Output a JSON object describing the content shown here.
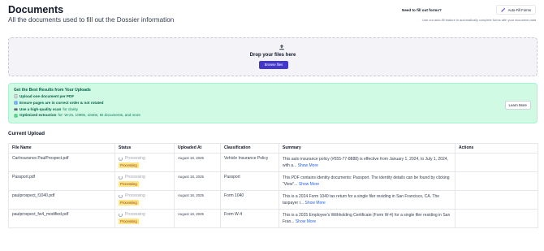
{
  "header": {
    "title": "Documents",
    "subtitle": "All the documents used to fill out the Dossier information"
  },
  "autofill": {
    "question": "Need to fill out forms?",
    "button_label": "Auto-Fill Forms",
    "note": "Use our auto-fill feature to automatically complete forms with your document data"
  },
  "dropzone": {
    "title": "Drop your files here",
    "button_label": "Browse files"
  },
  "tips": {
    "title": "Get the Best Results from Your Uploads",
    "items": [
      {
        "icon": "page-icon",
        "bold": "Upload one document per PDF",
        "rest": ""
      },
      {
        "icon": "numbered-pages-icon",
        "bold": "Ensure pages are in correct order & not rotated",
        "rest": ""
      },
      {
        "icon": "camera-icon",
        "bold": "Use a high-quality scan",
        "rest": " for clarity"
      },
      {
        "icon": "check-icon",
        "bold": "Optimized extraction",
        "rest": " for: W-2s, 1099s, 1040s, ID documents, and more"
      }
    ],
    "learn_more": "Learn More"
  },
  "upload": {
    "section_title": "Current Upload",
    "columns": [
      "File Name",
      "Status",
      "Uploaded At",
      "Classification",
      "Summary",
      "Actions"
    ],
    "rows": [
      {
        "file": "CarInsurance.PaulProspect.pdf",
        "status": "Processing",
        "badge": "Processing",
        "date": "August 18, 2025",
        "classification": "Vehicle Insurance Policy",
        "summary": "This auto insurance policy (#555-77-8888) is effective from January 1, 2024, to July 1, 2024, with a...",
        "more": "Show More"
      },
      {
        "file": "Passport.pdf",
        "status": "Processing",
        "badge": "Processing",
        "date": "August 18, 2025",
        "classification": "Passport",
        "summary": "This PDF contains identity documents: Passport. The identity details can be found by clicking \"View\"...",
        "more": "Show More"
      },
      {
        "file": "paulprospect_f1040.pdf",
        "status": "Processing",
        "badge": "Processing",
        "date": "August 18, 2025",
        "classification": "Form 1040",
        "summary": "This is a 2024 Form 1040 tax return for a single filer residing in San Francisco, CA. The taxpayer r...",
        "more": "Show More"
      },
      {
        "file": "paulprospect_fw4_modified.pdf",
        "status": "Processing",
        "badge": "Processing",
        "date": "August 18, 2025",
        "classification": "Form W-4",
        "summary": "This is a 2025 Employee's Withholding Certificate (Form W-4) for a single filer residing in San Fran...",
        "more": "Show More"
      }
    ]
  },
  "colors": {
    "primary": "#4338ca",
    "tips_bg": "#d1fae5",
    "badge_bg": "#fde68a",
    "link": "#2563eb"
  }
}
